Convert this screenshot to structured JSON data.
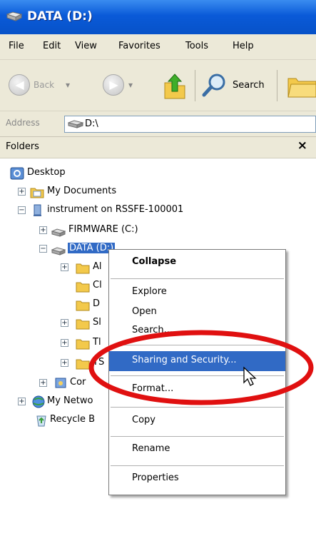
{
  "window": {
    "title": "DATA (D:)"
  },
  "menu": [
    "File",
    "Edit",
    "View",
    "Favorites",
    "Tools",
    "Help"
  ],
  "toolbar": {
    "back_label": "Back",
    "search_label": "Search"
  },
  "address": {
    "label": "Address",
    "value": "D:\\"
  },
  "folders_pane": {
    "title": "Folders",
    "close_glyph": "×"
  },
  "tree": {
    "desktop": "Desktop",
    "my_documents": "My Documents",
    "instrument": "instrument on RSSFE-100001",
    "firmware": "FIRMWARE (C:)",
    "data": "DATA (D:)",
    "sub1": "Al",
    "sub2": "Cl",
    "sub3": "D",
    "sub4": "Sl",
    "sub5": "Tl",
    "sub6": "TS",
    "control": "Cor",
    "network": "My Netwo",
    "recycle": "Recycle B"
  },
  "context_menu": {
    "collapse": "Collapse",
    "explore": "Explore",
    "open": "Open",
    "search": "Search...",
    "sharing": "Sharing and Security...",
    "format": "Format...",
    "copy": "Copy",
    "rename": "Rename",
    "properties": "Properties"
  },
  "colors": {
    "title_bar": "#0a5ad8",
    "selection": "#316ac5",
    "annotation_ellipse": "#e01010"
  }
}
